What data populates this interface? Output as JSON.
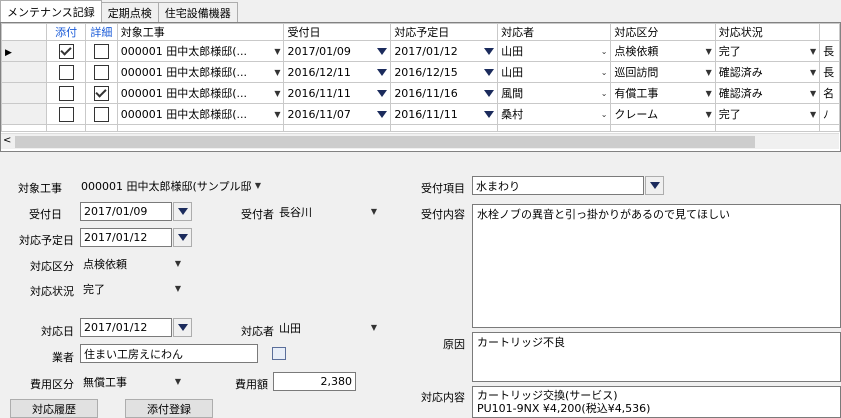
{
  "tabs": [
    "メンテナンス記録",
    "定期点検",
    "住宅設備機器"
  ],
  "grid": {
    "headers": [
      "添付",
      "詳細",
      "対象工事",
      "受付日",
      "対応予定日",
      "対応者",
      "対応区分",
      "対応状況"
    ],
    "rows": [
      {
        "attach": true,
        "detail": false,
        "project": "000001 田中太郎様邸(...",
        "received": "2017/01/09",
        "scheduled": "2017/01/12",
        "person": "山田",
        "category": "点検依頼",
        "status": "完了",
        "extra": "長"
      },
      {
        "attach": false,
        "detail": false,
        "project": "000001 田中太郎様邸(...",
        "received": "2016/12/11",
        "scheduled": "2016/12/15",
        "person": "山田",
        "category": "巡回訪問",
        "status": "確認済み",
        "extra": "長"
      },
      {
        "attach": false,
        "detail": true,
        "project": "000001 田中太郎様邸(...",
        "received": "2016/11/11",
        "scheduled": "2016/11/16",
        "person": "風間",
        "category": "有償工事",
        "status": "確認済み",
        "extra": "名"
      },
      {
        "attach": false,
        "detail": false,
        "project": "000001 田中太郎様邸(...",
        "received": "2016/11/07",
        "scheduled": "2016/11/11",
        "person": "桑村",
        "category": "クレーム",
        "status": "完了",
        "extra": "ﾉ"
      }
    ]
  },
  "form": {
    "project_label": "対象工事",
    "project_value": "000001 田中太郎様邸(サンプル邸",
    "received_label": "受付日",
    "received_value": "2017/01/09",
    "receiver_label": "受付者",
    "receiver_value": "長谷川",
    "scheduled_label": "対応予定日",
    "scheduled_value": "2017/01/12",
    "category_label": "対応区分",
    "category_value": "点検依頼",
    "status_label": "対応状況",
    "status_value": "完了",
    "response_date_label": "対応日",
    "response_date_value": "2017/01/12",
    "responder_label": "対応者",
    "responder_value": "山田",
    "vendor_label": "業者",
    "vendor_value": "住まい工房えにわん",
    "cost_type_label": "費用区分",
    "cost_type_value": "無償工事",
    "cost_label": "費用額",
    "cost_value": "2,380",
    "item_label": "受付項目",
    "item_value": "水まわり",
    "content_label": "受付内容",
    "content_value": "水栓ノブの異音と引っ掛かりがあるので見てほしい",
    "cause_label": "原因",
    "cause_value": "カートリッジ不良",
    "response_label": "対応内容",
    "response_line1": "カートリッジ交換(サービス)",
    "response_line2": "PU101-9NX ¥4,200(税込¥4,536)"
  },
  "buttons": {
    "history": "対応履歴",
    "attach": "添付登録"
  }
}
